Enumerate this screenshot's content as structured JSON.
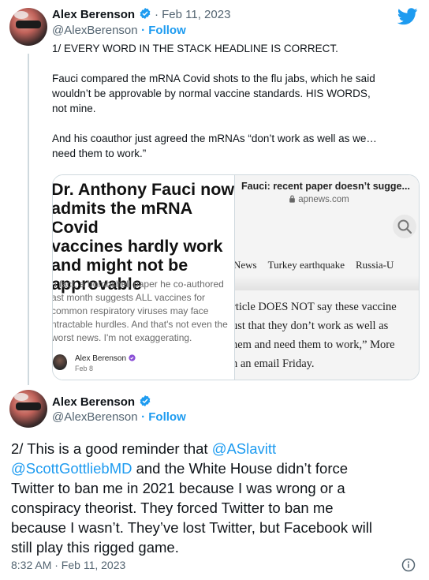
{
  "tweet1": {
    "author_name": "Alex Berenson",
    "date": "· Feb 11, 2023",
    "handle": "@AlexBerenson",
    "follow_label": "· Follow",
    "para1": "1/ EVERY WORD IN THE STACK HEADLINE IS CORRECT.",
    "para2_l1": "Fauci compared the mRNA Covid shots to the flu jabs, which he said",
    "para2_l2": "wouldn’t be approvable by normal vaccine standards. HIS WORDS,",
    "para2_l3": "not mine.",
    "para3_l1": "And his coauthor just agreed the mRNAs “don’t work as well as we…",
    "para3_l2": "need them to work.”"
  },
  "card": {
    "headline_l1": "Dr. Anthony Fauci now",
    "headline_l2": "admits the mRNA Covid",
    "headline_l3": "vaccines hardly work",
    "headline_l4": "and might not be",
    "headline_l5": "approvable",
    "sub_l1": "n fact, a bombshell paper he co-authored",
    "sub_l2": "ast month suggests ALL vaccines for",
    "sub_l3": "common respiratory viruses may face",
    "sub_l4": "ntractable hurdles. And that's not even the",
    "sub_l5": "worst news. I'm not exaggerating.",
    "byline_name": "Alex Berenson",
    "byline_date": "Feb 8",
    "right_title": "Fauci: recent paper doesn’t sugge...",
    "right_url": "apnews.com",
    "nav": [
      "News",
      "Turkey earthquake",
      "Russia-U"
    ],
    "body_l1": "rticle DOES NOT say these vaccine",
    "body_l2": "ust that they don’t work as well as",
    "body_l3": "nem and need them to work,” More",
    "body_l4": "n an email Friday."
  },
  "tweet2": {
    "author_name": "Alex Berenson",
    "handle": "@AlexBerenson",
    "follow_label": "· Follow",
    "l1_a": "2/ This is a good reminder that ",
    "l1_link": "@ASlavitt",
    "l2_link": "@ScottGottliebMD",
    "l2_b": " and the White House didn’t force",
    "l3": "Twitter to ban me in 2021 because I was wrong or a",
    "l4": "conspiracy theorist. They forced Twitter to ban me",
    "l5": "because I wasn’t. They’ve lost Twitter, but Facebook will",
    "l6": "still play this rigged game.",
    "timestamp": "8:32 AM · Feb 11, 2023"
  },
  "colors": {
    "accent": "#1d9bf0",
    "text": "#0f1419",
    "secondary": "#536471"
  },
  "icons": [
    "twitter-bird-icon",
    "verified-badge-icon",
    "lock-icon",
    "search-icon",
    "info-icon"
  ]
}
